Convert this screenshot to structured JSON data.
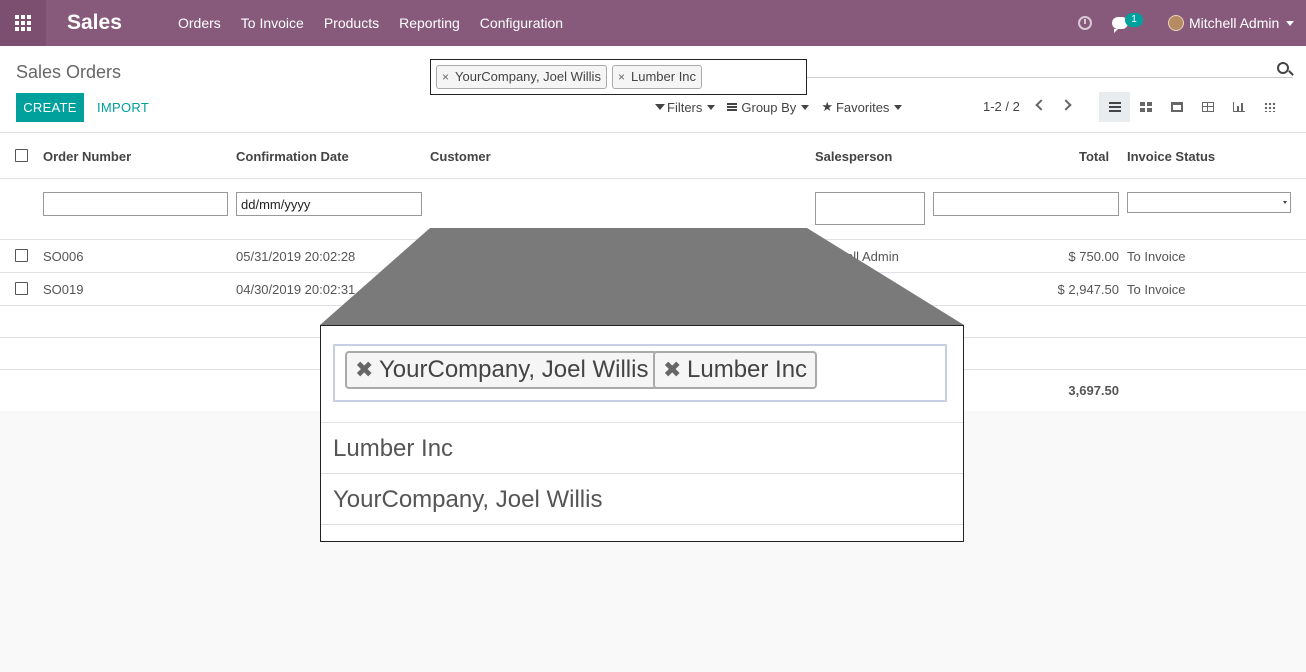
{
  "navbar": {
    "brand": "Sales",
    "menu": [
      "Orders",
      "To Invoice",
      "Products",
      "Reporting",
      "Configuration"
    ],
    "messages_count": "1",
    "user_name": "Mitchell Admin"
  },
  "control_panel": {
    "title": "Sales Orders",
    "search_placeholder": "Search...",
    "create_label": "CREATE",
    "import_label": "IMPORT",
    "filters_label": "Filters",
    "groupby_label": "Group By",
    "favorites_label": "Favorites",
    "pager": "1-2 / 2"
  },
  "table": {
    "headers": {
      "order_number": "Order Number",
      "confirmation_date": "Confirmation Date",
      "customer": "Customer",
      "salesperson": "Salesperson",
      "total": "Total",
      "invoice_status": "Invoice Status"
    },
    "filter_date_value": "dd/mm/yyyy",
    "customer_tags": [
      "YourCompany, Joel Willis",
      "Lumber Inc"
    ],
    "rows": [
      {
        "number": "SO006",
        "date": "05/31/2019 20:02:28",
        "salesperson": "Mitchell Admin",
        "total": "$ 750.00",
        "status": "To Invoice"
      },
      {
        "number": "SO019",
        "date": "04/30/2019 20:02:31",
        "salesperson": "",
        "total": "$ 2,947.50",
        "status": "To Invoice"
      }
    ],
    "grand_total": "3,697.50"
  },
  "zoom": {
    "tags": [
      "YourCompany, Joel Willis",
      "Lumber Inc"
    ],
    "options": [
      "Lumber Inc",
      "YourCompany, Joel Willis"
    ]
  },
  "colors": {
    "primary": "#875a7b",
    "accent": "#00a09d"
  }
}
